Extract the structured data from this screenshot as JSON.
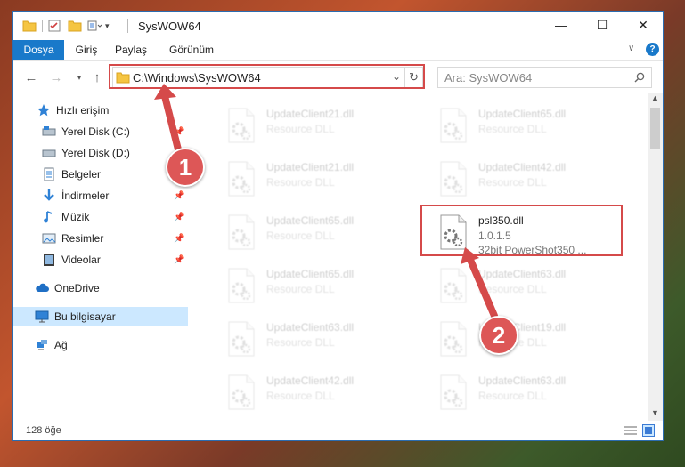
{
  "window": {
    "title": "SysWOW64",
    "caption_buttons": {
      "minimize": "—",
      "maximize": "☐",
      "close": "✕"
    }
  },
  "ribbon": {
    "tabs": [
      {
        "label": "Dosya",
        "active": true
      },
      {
        "label": "Giriş",
        "active": false
      },
      {
        "label": "Paylaş",
        "active": false
      },
      {
        "label": "Görünüm",
        "active": false
      }
    ],
    "help_glyph": "?"
  },
  "address_bar": {
    "path": "C:\\Windows\\SysWOW64",
    "refresh_glyph": "↻",
    "dropdown_glyph": "⌄"
  },
  "search": {
    "placeholder": "Ara: SysWOW64"
  },
  "sidebar": {
    "items": [
      {
        "label": "Hızlı erişim",
        "icon": "star-icon",
        "pinned": false
      },
      {
        "label": "Yerel Disk (C:)",
        "icon": "drive-icon",
        "pinned": true
      },
      {
        "label": "Yerel Disk (D:)",
        "icon": "drive-icon",
        "pinned": false
      },
      {
        "label": "Belgeler",
        "icon": "documents-icon",
        "pinned": true
      },
      {
        "label": "İndirmeler",
        "icon": "download-icon",
        "pinned": true
      },
      {
        "label": "Müzik",
        "icon": "music-icon",
        "pinned": true
      },
      {
        "label": "Resimler",
        "icon": "pictures-icon",
        "pinned": true
      },
      {
        "label": "Videolar",
        "icon": "video-icon",
        "pinned": true
      },
      {
        "label": "OneDrive",
        "icon": "cloud-icon",
        "pinned": false
      },
      {
        "label": "Bu bilgisayar",
        "icon": "computer-icon",
        "pinned": false,
        "selected": true
      },
      {
        "label": "Ağ",
        "icon": "network-icon",
        "pinned": false
      }
    ]
  },
  "files": {
    "left_column": [
      {
        "name": "UpdateClient21.dll",
        "sub1": "Resource DLL",
        "sub2": ""
      },
      {
        "name": "UpdateClient21.dll",
        "sub1": "Resource DLL",
        "sub2": ""
      },
      {
        "name": "UpdateClient65.dll",
        "sub1": "Resource DLL",
        "sub2": ""
      },
      {
        "name": "UpdateClient65.dll",
        "sub1": "Resource DLL",
        "sub2": ""
      },
      {
        "name": "UpdateClient63.dll",
        "sub1": "Resource DLL",
        "sub2": ""
      },
      {
        "name": "UpdateClient42.dll",
        "sub1": "Resource DLL",
        "sub2": ""
      }
    ],
    "right_column": [
      {
        "name": "UpdateClient65.dll",
        "sub1": "Resource DLL",
        "sub2": ""
      },
      {
        "name": "UpdateClient42.dll",
        "sub1": "Resource DLL",
        "sub2": ""
      },
      {
        "name": "psl350.dll",
        "sub1": "1.0.1.5",
        "sub2": "32bit PowerShot350 ...",
        "highlighted": true
      },
      {
        "name": "UpdateClient63.dll",
        "sub1": "Resource DLL",
        "sub2": ""
      },
      {
        "name": "UpdateClient19.dll",
        "sub1": "Resource DLL",
        "sub2": ""
      },
      {
        "name": "UpdateClient63.dll",
        "sub1": "Resource DLL",
        "sub2": ""
      }
    ]
  },
  "status_bar": {
    "item_count": "128 öğe"
  },
  "annotations": {
    "step1": "1",
    "step2": "2",
    "color": "#d54a4a"
  }
}
